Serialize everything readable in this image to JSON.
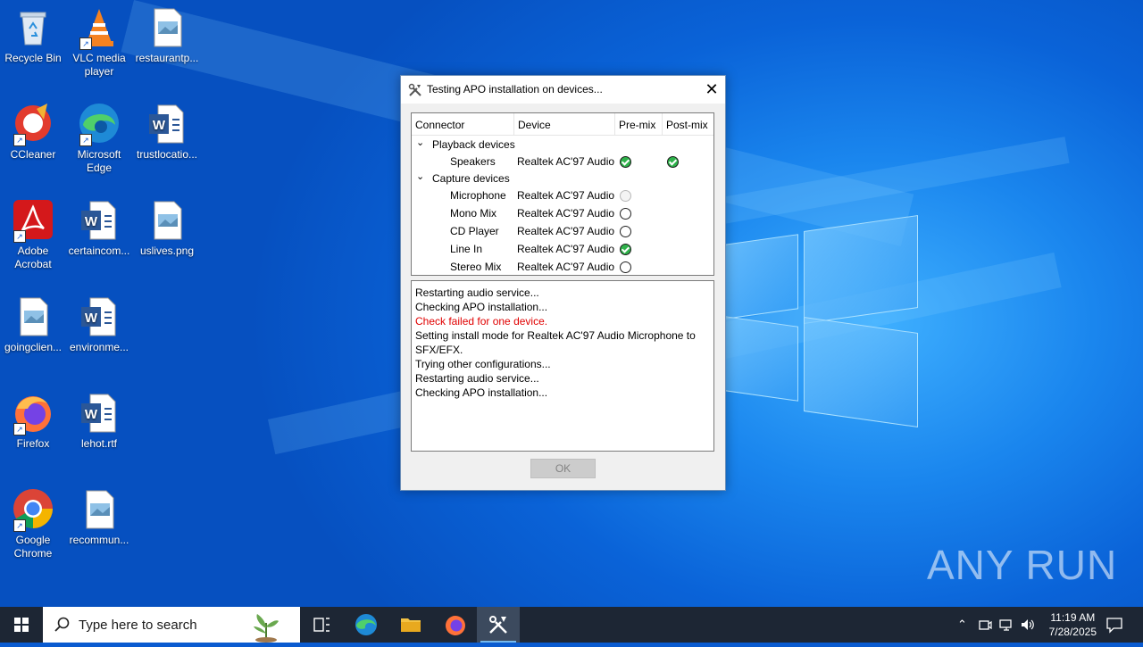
{
  "desktop": {
    "icons": [
      {
        "label": "Recycle Bin",
        "icon": "recycle-bin-icon"
      },
      {
        "label": "VLC media player",
        "icon": "vlc-icon"
      },
      {
        "label": "restaurantp...",
        "icon": "image-file-icon"
      },
      {
        "label": "CCleaner",
        "icon": "ccleaner-icon"
      },
      {
        "label": "Microsoft Edge",
        "icon": "edge-icon"
      },
      {
        "label": "trustlocatio...",
        "icon": "word-doc-icon"
      },
      {
        "label": "Adobe Acrobat",
        "icon": "acrobat-icon"
      },
      {
        "label": "certaincom...",
        "icon": "word-doc-icon"
      },
      {
        "label": "uslives.png",
        "icon": "image-file-icon"
      },
      {
        "label": "goingclien...",
        "icon": "image-file-icon"
      },
      {
        "label": "environme...",
        "icon": "word-doc-icon"
      },
      {
        "label": "Firefox",
        "icon": "firefox-icon"
      },
      {
        "label": "lehot.rtf",
        "icon": "word-doc-icon"
      },
      {
        "label": "Google Chrome",
        "icon": "chrome-icon"
      },
      {
        "label": "recommun...",
        "icon": "image-file-icon"
      }
    ]
  },
  "dialog": {
    "title": "Testing APO installation on devices...",
    "columns": {
      "connector": "Connector",
      "device": "Device",
      "premix": "Pre-mix",
      "postmix": "Post-mix"
    },
    "groups": [
      {
        "label": "Playback devices"
      },
      {
        "label": "Capture devices"
      }
    ],
    "rows": [
      {
        "connector": "Speakers",
        "device": "Realtek AC'97 Audio",
        "premix": "ok",
        "postmix": "ok"
      },
      {
        "connector": "Microphone",
        "device": "Realtek AC'97 Audio",
        "premix": "disabled",
        "postmix": ""
      },
      {
        "connector": "Mono Mix",
        "device": "Realtek AC'97 Audio",
        "premix": "empty",
        "postmix": ""
      },
      {
        "connector": "CD Player",
        "device": "Realtek AC'97 Audio",
        "premix": "empty",
        "postmix": ""
      },
      {
        "connector": "Line In",
        "device": "Realtek AC'97 Audio",
        "premix": "ok",
        "postmix": ""
      },
      {
        "connector": "Stereo Mix",
        "device": "Realtek AC'97 Audio",
        "premix": "empty",
        "postmix": ""
      }
    ],
    "log": [
      {
        "text": "Restarting audio service...",
        "error": false
      },
      {
        "text": "Checking APO installation...",
        "error": false
      },
      {
        "text": "Check failed for one device.",
        "error": true
      },
      {
        "text": "Setting install mode for Realtek AC'97 Audio Microphone to",
        "error": false
      },
      {
        "text": "SFX/EFX.",
        "error": false
      },
      {
        "text": "Trying other configurations...",
        "error": false
      },
      {
        "text": "Restarting audio service...",
        "error": false
      },
      {
        "text": "Checking APO installation...",
        "error": false
      }
    ],
    "ok_label": "OK",
    "close_glyph": "✕"
  },
  "taskbar": {
    "search_placeholder": "Type here to search",
    "time": "11:19 AM",
    "date": "7/28/2025"
  },
  "watermark": "ANY RUN",
  "colors": {
    "error_text": "#e00000",
    "status_ok": "#2fb24b",
    "taskbar": "#1d2634"
  }
}
